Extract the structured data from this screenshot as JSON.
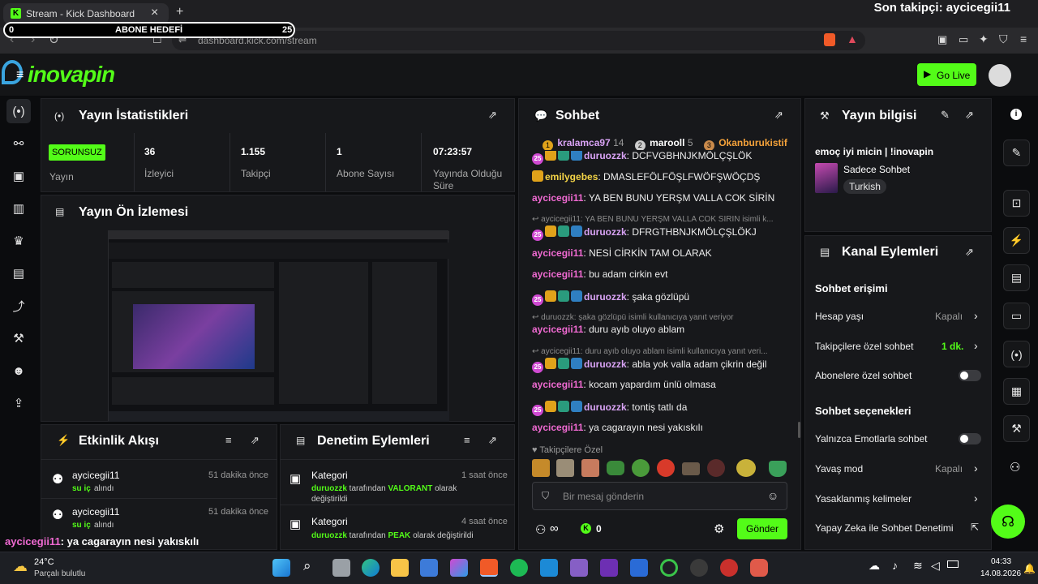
{
  "browser": {
    "tab_title": "Stream - Kick Dashboard",
    "url": "dashboard.kick.com/stream",
    "new_tab": "+",
    "close": "×"
  },
  "overlay": {
    "goal_min": "0",
    "goal_label": "ABONE HEDEFİ",
    "goal_max": "25",
    "last_follower": "Son takipçi: aycicegii11",
    "chat_msg_user": "aycicegii11",
    "chat_msg_text": ": ya cagarayın nesi yakıskılı"
  },
  "header": {
    "go_live": "Go Live"
  },
  "stats": {
    "title": "Yayın İstatistikleri",
    "status": "SORUNSUZ",
    "status_label": "Yayın",
    "items": [
      {
        "value": "36",
        "label": "İzleyici"
      },
      {
        "value": "1.155",
        "label": "Takipçi"
      },
      {
        "value": "1",
        "label": "Abone Sayısı"
      },
      {
        "value": "07:23:57",
        "label": "Yayında Olduğu Süre"
      }
    ]
  },
  "preview": {
    "title": "Yayın Ön İzlemesi"
  },
  "activity": {
    "title": "Etkinlik Akışı",
    "items": [
      {
        "user": "aycicegii11",
        "action": "su iç",
        "suffix": "alındı",
        "time": "51 dakika önce"
      },
      {
        "user": "aycicegii11",
        "action": "su iç",
        "suffix": "alındı",
        "time": "51 dakika önce"
      }
    ]
  },
  "moderation": {
    "title": "Denetim Eylemleri",
    "items": [
      {
        "kind": "Kategori",
        "by": "duruozzk",
        "mid": "tarafından",
        "value": "VALORANT",
        "end": "olarak değiştirildi",
        "time": "1 saat önce"
      },
      {
        "kind": "Kategori",
        "by": "duruozzk",
        "mid": "tarafından",
        "value": "PEAK",
        "end": "olarak değiştirildi",
        "time": "4 saat önce"
      }
    ]
  },
  "chat": {
    "title": "Sohbet",
    "top": [
      {
        "rank": "1",
        "name": "kralamca97",
        "n": "14"
      },
      {
        "rank": "2",
        "name": "marooll",
        "n": "5"
      },
      {
        "rank": "3",
        "name": "Okanburukistif",
        "n": ""
      }
    ],
    "messages": [
      {
        "user": "duruozzk",
        "text": "DCFVGBHNJKMÖLÇŞLÖK",
        "color": "#d9a3f5"
      },
      {
        "user": "emilygebes",
        "text": "DMASLEFÖLFÖŞLFWÖFŞWÖÇDŞ",
        "color": "#f5d547"
      },
      {
        "user": "aycicegii11",
        "text": "YA BEN BUNU YERŞM VALLA COK SİRİN",
        "color": "#f06ad2"
      },
      {
        "reply": "aycicegii11: YA BEN BUNU YERŞM VALLA COK SİRİN isimli k..."
      },
      {
        "user": "duruozzk",
        "text": "DFRGTHBNJKMÖLÇŞLÖKJ",
        "color": "#d9a3f5"
      },
      {
        "user": "aycicegii11",
        "text": "NESİ CİRKİN TAM OLARAK",
        "color": "#f06ad2"
      },
      {
        "user": "aycicegii11",
        "text": "bu adam cirkin evt",
        "color": "#f06ad2"
      },
      {
        "user": "duruozzk",
        "text": "şaka gözlüpü",
        "color": "#d9a3f5"
      },
      {
        "reply": "duruozzk: şaka gözlüpü isimli kullanıcıya yanıt veriyor"
      },
      {
        "user": "aycicegii11",
        "text": "duru ayıb oluyo ablam",
        "color": "#f06ad2"
      },
      {
        "reply": "aycicegii11: duru ayıb oluyo ablam isimli kullanıcıya yanıt veri..."
      },
      {
        "user": "duruozzk",
        "text": "abla yok valla adam çikrin değil",
        "color": "#d9a3f5"
      },
      {
        "user": "aycicegii11",
        "text": "kocam yapardım ünlü olmasa",
        "color": "#f06ad2"
      },
      {
        "user": "duruozzk",
        "text": "tontiş tatlı da",
        "color": "#d9a3f5"
      },
      {
        "user": "aycicegii11",
        "text": "ya cagarayın nesi yakıskılı",
        "color": "#f06ad2"
      }
    ],
    "followers_only": "Takipçilere Özel",
    "placeholder": "Bir mesaj gönderin",
    "points": "0",
    "send": "Gönder"
  },
  "info": {
    "title": "Yayın bilgisi",
    "stream_title": "emoç iyi micin | !inovapin",
    "category": "Sadece Sohbet",
    "language": "Turkish"
  },
  "channel": {
    "title": "Kanal Eylemleri",
    "access": "Sohbet erişimi",
    "account_age": "Hesap yaşı",
    "account_age_val": "Kapalı",
    "followers_chat": "Takipçilere özel sohbet",
    "followers_chat_val": "1 dk.",
    "subs_chat": "Abonelere özel sohbet",
    "options": "Sohbet seçenekleri",
    "emote_only": "Yalnızca Emotlarla sohbet",
    "slow": "Yavaş mod",
    "slow_val": "Kapalı",
    "banned_words": "Yasaklanmış kelimeler",
    "ai_mod": "Yapay Zeka ile Sohbet Denetimi"
  },
  "taskbar": {
    "temp": "24°C",
    "weather": "Parçalı bulutlu",
    "time": "04:33",
    "date": "14.08.2026"
  },
  "colors": {
    "accent": "#53fc18",
    "panel": "#17181b",
    "bg": "#0b0c0e"
  }
}
